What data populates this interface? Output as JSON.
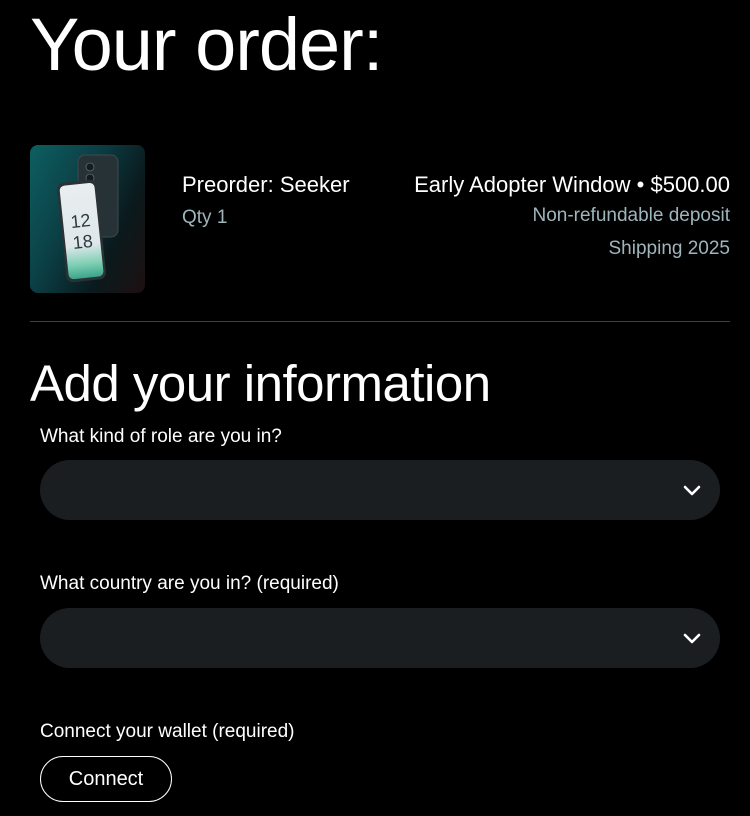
{
  "order": {
    "title": "Your order:",
    "item": {
      "name": "Preorder: Seeker",
      "qty": "Qty 1",
      "price_line": "Early Adopter Window • $500.00",
      "deposit_note": "Non-refundable deposit",
      "shipping_note": "Shipping 2025",
      "phone_screen_time": [
        "12",
        "18"
      ]
    }
  },
  "info": {
    "title": "Add your information",
    "role": {
      "label": "What kind of role are you in?",
      "value": ""
    },
    "country": {
      "label": "What country are you in? (required)",
      "value": ""
    },
    "wallet": {
      "label": "Connect your wallet (required)",
      "button_label": "Connect"
    }
  },
  "colors": {
    "background": "#000000",
    "muted_text": "#9eb5bc",
    "select_bg": "#1b1e21",
    "divider": "#3b4246"
  },
  "icons": {
    "select_chevron": "chevron-down-icon"
  }
}
